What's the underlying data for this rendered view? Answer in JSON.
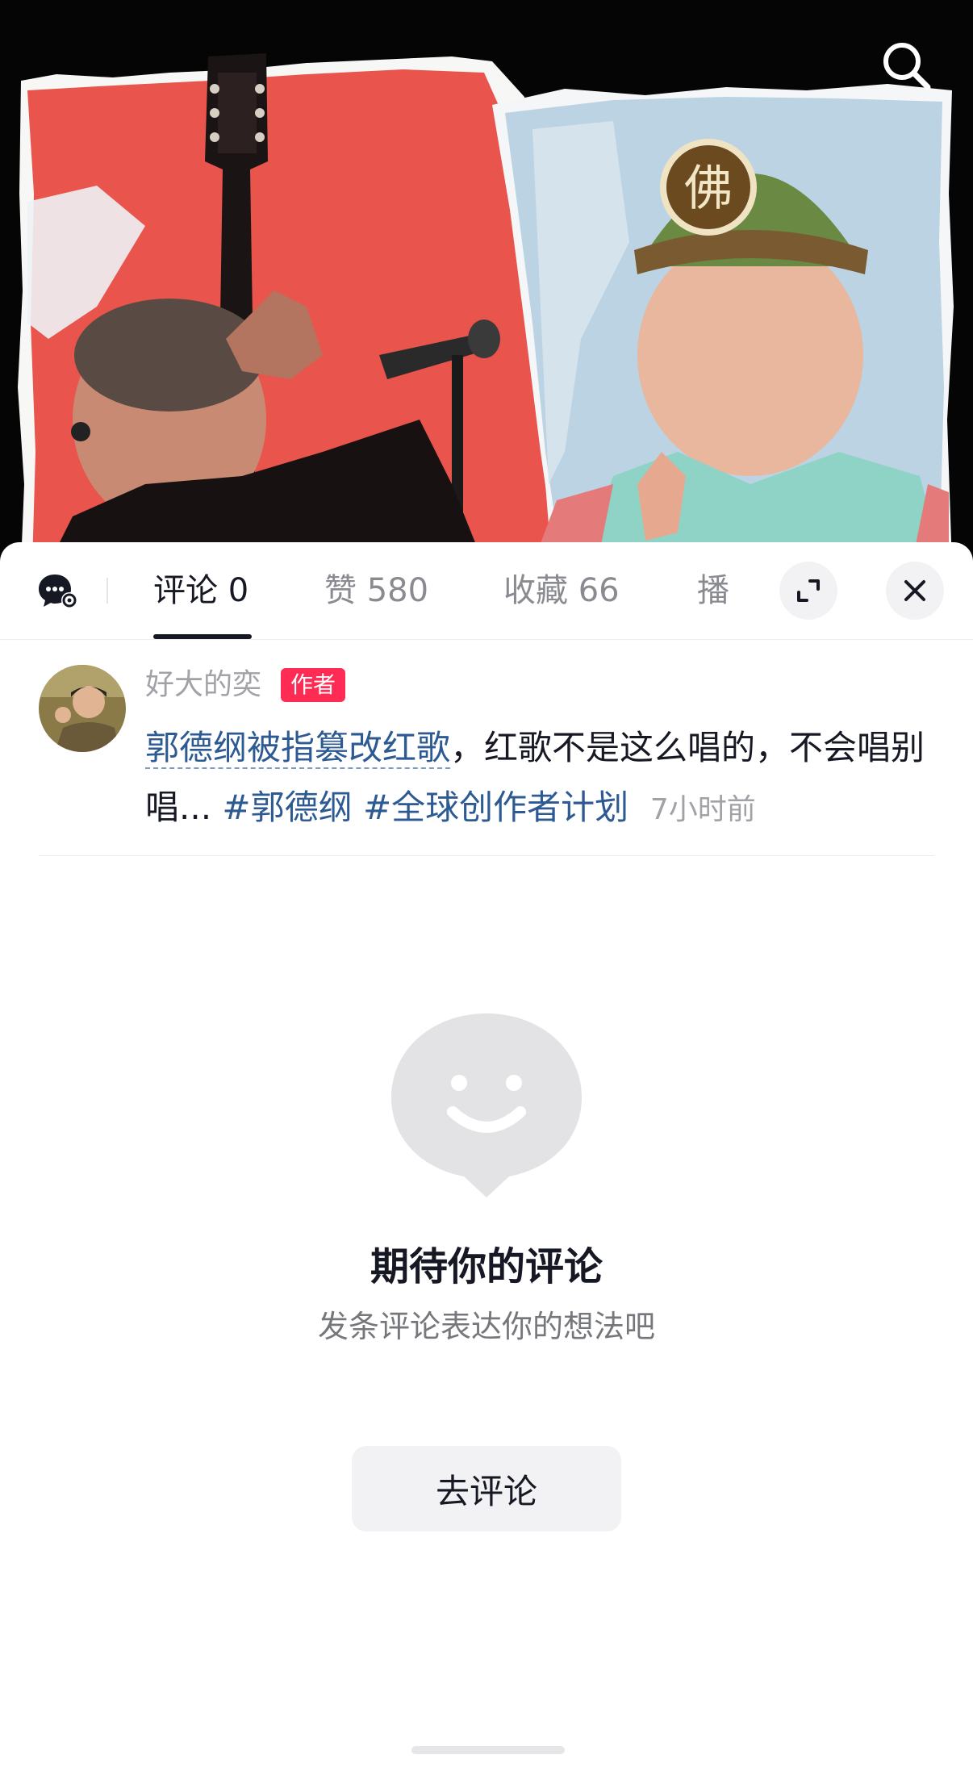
{
  "icons": {
    "search": "search-icon",
    "chat_settings": "chat-settings-icon",
    "expand": "expand-icon",
    "close": "close-icon",
    "empty_state": "smiley-chat-bubble-icon"
  },
  "tabs": [
    {
      "label": "评论 0",
      "active": true
    },
    {
      "label": "赞 580",
      "active": false
    },
    {
      "label": "收藏 66",
      "active": false
    },
    {
      "label": "播",
      "active": false
    }
  ],
  "post": {
    "author_name": "好大的奕",
    "author_badge": "作者",
    "title_link": "郭德纲被指篡改红歌",
    "text": "，红歌不是这么唱的，不会唱别唱... ",
    "hashtags": [
      "#郭德纲",
      "#全球创作者计划"
    ],
    "time": "7小时前"
  },
  "empty_state": {
    "title": "期待你的评论",
    "subtitle": "发条评论表达你的想法吧",
    "button_label": "去评论"
  },
  "colors": {
    "accent": "#fe2c55",
    "link": "#2d5a92",
    "text_primary": "#161823",
    "text_secondary": "#a1a2a7"
  }
}
